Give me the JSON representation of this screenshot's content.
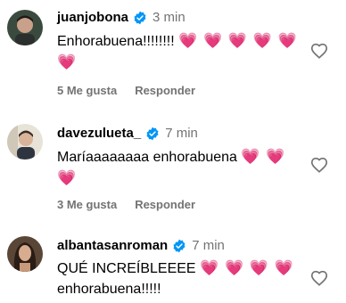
{
  "comments": [
    {
      "username": "juanjobona",
      "time": "3 min",
      "text": "Enhorabuena!!!!!!!!",
      "hearts": "💗 💗 💗 💗 💗 💗",
      "likes": "5 Me gusta",
      "reply": "Responder",
      "verified": true
    },
    {
      "username": "davezulueta_",
      "time": "7 min",
      "text": "Maríaaaaaaaa enhorabuena",
      "hearts": "💗 💗 💗",
      "likes": "3 Me gusta",
      "reply": "Responder",
      "verified": true
    },
    {
      "username": "albantasanroman",
      "time": "7 min",
      "text": "QUÉ INCREÍBLEEEE",
      "hearts": "💗 💗 💗 💗",
      "text2": "enhorabuena!!!!!",
      "verified": true
    }
  ],
  "colors": {
    "verified": "#0095f6",
    "muted": "#737373",
    "heart": "#ff3b6b"
  },
  "icons": [
    "verified-badge-icon",
    "heart-outline-icon"
  ]
}
